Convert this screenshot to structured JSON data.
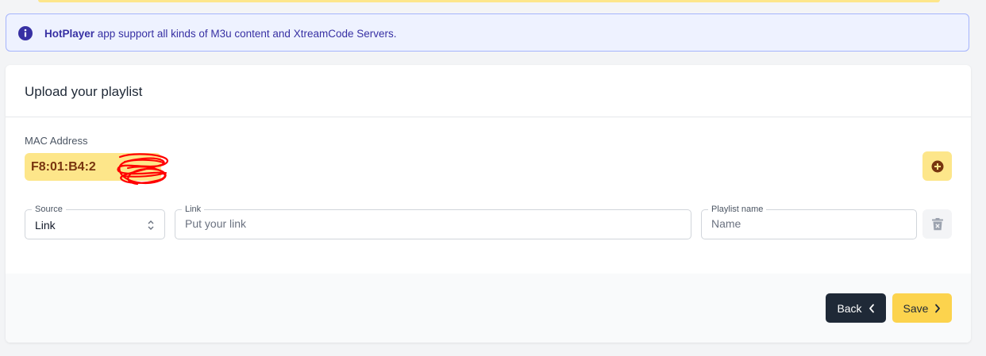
{
  "info_banner": {
    "brand": "HotPlayer",
    "text": " app support all kinds of M3u content and XtreamCode Servers.",
    "icon": "info-circle-icon"
  },
  "card": {
    "title": "Upload your playlist"
  },
  "mac": {
    "label": "MAC Address",
    "value": "F8:01:B4:2"
  },
  "source": {
    "label": "Source",
    "value": "Link"
  },
  "link": {
    "label": "Link",
    "placeholder": "Put your link"
  },
  "playlist_name": {
    "label": "Playlist name",
    "placeholder": "Name"
  },
  "buttons": {
    "back": "Back",
    "save": "Save"
  },
  "colors": {
    "accent_yellow": "#fcd34d",
    "dark": "#1f2937",
    "info_bg": "#eef2ff",
    "info_text": "#3730a3"
  }
}
